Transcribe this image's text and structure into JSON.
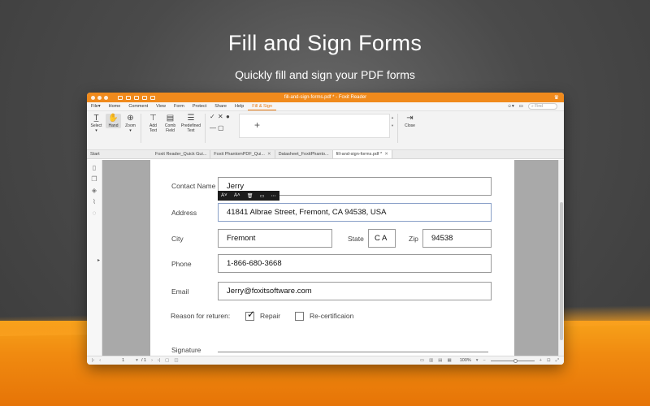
{
  "hero": {
    "title": "Fill and Sign Forms",
    "subtitle": "Quickly fill and sign your PDF forms"
  },
  "window": {
    "title": "fill-and-sign-forms.pdf * - Foxit Reader"
  },
  "menu": {
    "items": [
      "File",
      "Home",
      "Comment",
      "View",
      "Form",
      "Protect",
      "Share",
      "Help",
      "Fill & Sign"
    ],
    "active": "Fill & Sign",
    "find_placeholder": "Find"
  },
  "ribbon": {
    "select": "Select",
    "hand": "Hand",
    "zoom": "Zoom",
    "add_text_1": "Add",
    "add_text_2": "Text",
    "comb_field_1": "Comb",
    "comb_field_2": "Field",
    "predefined_1": "Predefined",
    "predefined_2": "Text",
    "close": "Close",
    "add_signature": "+"
  },
  "tabs": {
    "start": "Start",
    "items": [
      "Foxit Reader_Quick Gui...",
      "Foxit PhantomPDF_Qui...",
      "Datasheet_FoxitPhanto...",
      "fill-and-sign-forms.pdf *"
    ]
  },
  "form": {
    "contact_label": "Contact Name",
    "contact_value": "Jerry",
    "address_label": "Address",
    "address_value": "41841 Albrae Street, Fremont, CA 94538, USA",
    "city_label": "City",
    "city_value": "Fremont",
    "state_label": "State",
    "state_value": "C A",
    "zip_label": "Zip",
    "zip_value": "94538",
    "phone_label": "Phone",
    "phone_value": "1-866-680-3668",
    "email_label": "Email",
    "email_value": "Jerry@foxitsoftware.com",
    "reason_label": "Reason for returen:",
    "repair_label": "Repair",
    "repair_checked": true,
    "recert_label": "Re-certificaion",
    "recert_checked": false,
    "signature_label": "Signature"
  },
  "status": {
    "page_current": "1",
    "page_total": "/ 1",
    "zoom": "100%"
  }
}
